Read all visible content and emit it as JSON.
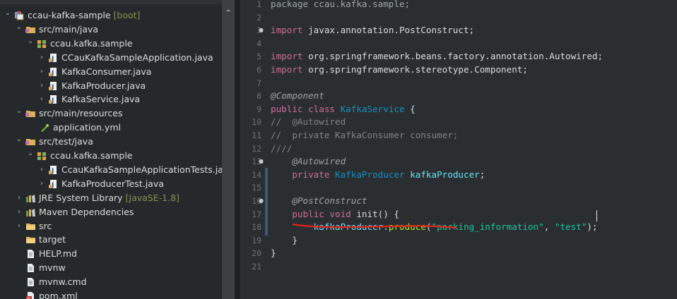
{
  "explorer": {
    "items": [
      {
        "label": "ccau-kafka-sample",
        "decoration": " [boot]",
        "icon": "project-icon",
        "arrow": "expanded"
      },
      {
        "label": "src/main/java",
        "icon": "source-folder-icon",
        "arrow": "expanded"
      },
      {
        "label": "ccau.kafka.sample",
        "icon": "package-icon",
        "arrow": "expanded"
      },
      {
        "label": "CCauKafkaSampleApplication.java",
        "icon": "java-file-icon",
        "arrow": "collapsed"
      },
      {
        "label": "KafkaConsumer.java",
        "icon": "java-file-icon",
        "arrow": "collapsed"
      },
      {
        "label": "KafkaProducer.java",
        "icon": "java-file-icon",
        "arrow": "collapsed"
      },
      {
        "label": "KafkaService.java",
        "icon": "java-file-icon",
        "arrow": "collapsed"
      },
      {
        "label": "src/main/resources",
        "icon": "source-folder-icon",
        "arrow": "expanded"
      },
      {
        "label": "application.yml",
        "icon": "yml-file-icon",
        "arrow": ""
      },
      {
        "label": "src/test/java",
        "icon": "source-folder-icon",
        "arrow": "expanded"
      },
      {
        "label": "ccau.kafka.sample",
        "icon": "package-icon",
        "arrow": "expanded"
      },
      {
        "label": "CcauKafkaSampleApplicationTests.ja",
        "icon": "java-file-icon",
        "arrow": "collapsed"
      },
      {
        "label": "KafkaProducerTest.java",
        "icon": "java-file-icon",
        "arrow": "collapsed"
      },
      {
        "label": "JRE System Library",
        "decoration": " [JavaSE-1.8]",
        "icon": "library-icon",
        "arrow": "collapsed"
      },
      {
        "label": "Maven Dependencies",
        "icon": "library-icon",
        "arrow": "collapsed"
      },
      {
        "label": "src",
        "icon": "folder-icon",
        "arrow": "collapsed"
      },
      {
        "label": "target",
        "icon": "folder-icon",
        "arrow": ""
      },
      {
        "label": "HELP.md",
        "icon": "file-icon",
        "arrow": ""
      },
      {
        "label": "mvnw",
        "icon": "file-icon",
        "arrow": ""
      },
      {
        "label": "mvnw.cmd",
        "icon": "file-icon",
        "arrow": ""
      },
      {
        "label": "pom.xml",
        "icon": "xml-file-icon",
        "arrow": ""
      }
    ]
  },
  "editor": {
    "lines": [
      {
        "num": "1",
        "fold": "",
        "tokens": [
          {
            "t": "package ccau.kafka.sample;",
            "c": "partial"
          }
        ]
      },
      {
        "num": "2",
        "fold": "",
        "tokens": []
      },
      {
        "num": "3",
        "fold": "●",
        "tokens": [
          {
            "t": "import",
            "c": "kw"
          },
          {
            "t": " javax.annotation.PostConstruct;",
            "c": ""
          }
        ]
      },
      {
        "num": "4",
        "fold": "",
        "tokens": []
      },
      {
        "num": "5",
        "fold": "",
        "tokens": [
          {
            "t": "import",
            "c": "kw"
          },
          {
            "t": " org.springframework.beans.factory.annotation.Autowired;",
            "c": ""
          }
        ]
      },
      {
        "num": "6",
        "fold": "",
        "tokens": [
          {
            "t": "import",
            "c": "kw"
          },
          {
            "t": " org.springframework.stereotype.Component;",
            "c": ""
          }
        ]
      },
      {
        "num": "7",
        "fold": "",
        "tokens": []
      },
      {
        "num": "8",
        "fold": "",
        "tokens": [
          {
            "t": "@Component",
            "c": "ann"
          }
        ]
      },
      {
        "num": "9",
        "fold": "",
        "tokens": [
          {
            "t": "public class",
            "c": "kw"
          },
          {
            "t": " ",
            "c": ""
          },
          {
            "t": "KafkaService",
            "c": "cls"
          },
          {
            "t": " {",
            "c": ""
          }
        ]
      },
      {
        "num": "10",
        "fold": "",
        "tokens": [
          {
            "t": "//  @Autowired",
            "c": "cm"
          }
        ]
      },
      {
        "num": "11",
        "fold": "",
        "tokens": [
          {
            "t": "//  private KafkaConsumer consumer;",
            "c": "cm"
          }
        ]
      },
      {
        "num": "12",
        "fold": "",
        "tokens": [
          {
            "t": "////",
            "c": "cm"
          }
        ]
      },
      {
        "num": "13",
        "fold": "●",
        "tokens": [
          {
            "t": "    ",
            "c": ""
          },
          {
            "t": "@Autowired",
            "c": "ann"
          }
        ]
      },
      {
        "num": "14",
        "fold": "",
        "tokens": [
          {
            "t": "    ",
            "c": ""
          },
          {
            "t": "private",
            "c": "kw"
          },
          {
            "t": " ",
            "c": ""
          },
          {
            "t": "KafkaProducer",
            "c": "cls"
          },
          {
            "t": " ",
            "c": ""
          },
          {
            "t": "kafkaProducer",
            "c": "fld"
          },
          {
            "t": ";",
            "c": ""
          }
        ]
      },
      {
        "num": "15",
        "fold": "",
        "tokens": []
      },
      {
        "num": "16",
        "fold": "●",
        "tokens": [
          {
            "t": "    ",
            "c": ""
          },
          {
            "t": "@PostConstruct",
            "c": "ann"
          }
        ]
      },
      {
        "num": "17",
        "fold": "",
        "tokens": [
          {
            "t": "    ",
            "c": ""
          },
          {
            "t": "public void",
            "c": "kw"
          },
          {
            "t": " init() {",
            "c": ""
          }
        ]
      },
      {
        "num": "18",
        "fold": "",
        "tokens": [
          {
            "t": "        ",
            "c": ""
          },
          {
            "t": "kafkaProducer",
            "c": "fld"
          },
          {
            "t": ".",
            "c": ""
          },
          {
            "t": "produce",
            "c": "meth"
          },
          {
            "t": "(",
            "c": ""
          },
          {
            "t": "\"parking_information\"",
            "c": "str"
          },
          {
            "t": ", ",
            "c": ""
          },
          {
            "t": "\"test\"",
            "c": "str"
          },
          {
            "t": ");",
            "c": ""
          }
        ]
      },
      {
        "num": "19",
        "fold": "",
        "tokens": [
          {
            "t": "    }",
            "c": ""
          }
        ]
      },
      {
        "num": "20",
        "fold": "",
        "tokens": [
          {
            "t": "}",
            "c": ""
          }
        ]
      },
      {
        "num": "21",
        "fold": "",
        "tokens": []
      }
    ]
  }
}
